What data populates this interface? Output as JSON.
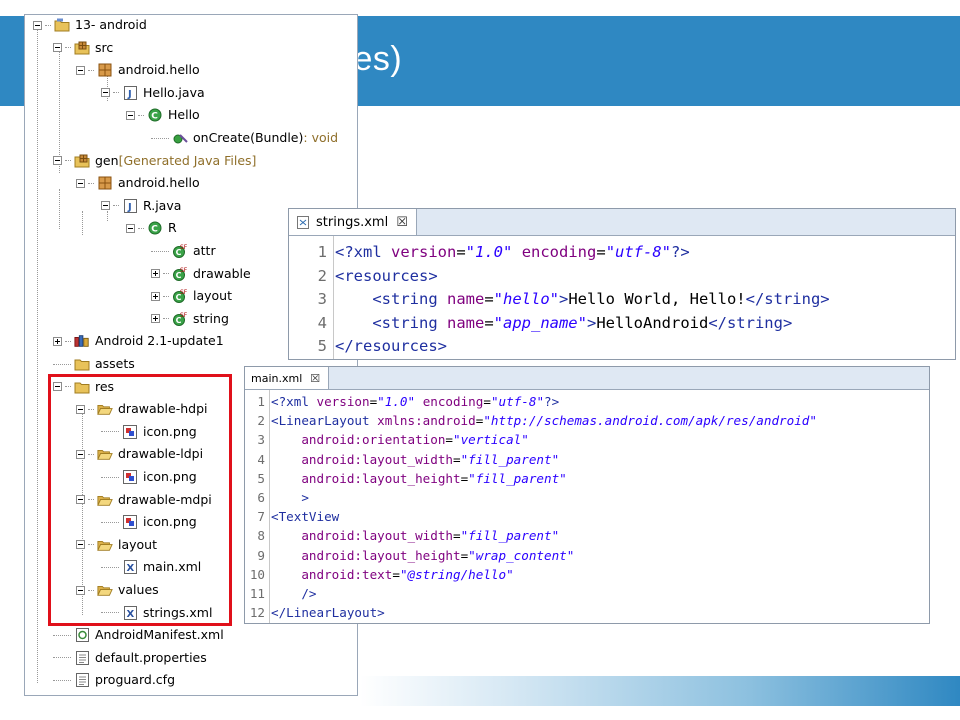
{
  "slide": {
    "title_fragment": "ces)"
  },
  "tree": [
    {
      "label": "13- android",
      "icon": "project-folder-icon"
    },
    {
      "label": "src",
      "icon": "source-folder-icon"
    },
    {
      "label": "android.hello",
      "icon": "package-icon"
    },
    {
      "label": "Hello.java",
      "icon": "java-file-icon"
    },
    {
      "label": "Hello",
      "icon": "class-icon"
    },
    {
      "label": "onCreate(Bundle)",
      "decor": " : void",
      "icon": "method-icon"
    },
    {
      "label": "gen",
      "decor": " [Generated Java Files]",
      "icon": "gen-folder-icon"
    },
    {
      "label": "android.hello",
      "icon": "package-icon"
    },
    {
      "label": "R.java",
      "icon": "java-file-icon"
    },
    {
      "label": "R",
      "icon": "class-icon"
    },
    {
      "label": "attr",
      "icon": "static-final-class-icon"
    },
    {
      "label": "drawable",
      "icon": "static-final-class-icon"
    },
    {
      "label": "layout",
      "icon": "static-final-class-icon"
    },
    {
      "label": "string",
      "icon": "static-final-class-icon"
    },
    {
      "label": "Android 2.1-update1",
      "icon": "library-icon"
    },
    {
      "label": "assets",
      "icon": "folder-icon"
    },
    {
      "label": "res",
      "icon": "folder-icon"
    },
    {
      "label": "drawable-hdpi",
      "icon": "open-folder-icon"
    },
    {
      "label": "icon.png",
      "icon": "image-file-icon"
    },
    {
      "label": "drawable-ldpi",
      "icon": "open-folder-icon"
    },
    {
      "label": "icon.png",
      "icon": "image-file-icon"
    },
    {
      "label": "drawable-mdpi",
      "icon": "open-folder-icon"
    },
    {
      "label": "icon.png",
      "icon": "image-file-icon"
    },
    {
      "label": "layout",
      "icon": "open-folder-icon"
    },
    {
      "label": "main.xml",
      "icon": "xml-file-icon"
    },
    {
      "label": "values",
      "icon": "open-folder-icon"
    },
    {
      "label": "strings.xml",
      "icon": "xml-file-icon"
    },
    {
      "label": "AndroidManifest.xml",
      "icon": "manifest-file-icon"
    },
    {
      "label": "default.properties",
      "icon": "text-file-icon"
    },
    {
      "label": "proguard.cfg",
      "icon": "text-file-icon"
    }
  ],
  "strings_editor": {
    "tab_label": "strings.xml",
    "close_glyph": "☒",
    "lines": [
      {
        "n": "1",
        "tokens": [
          [
            "tag",
            "<?xml "
          ],
          [
            "attr",
            "version"
          ],
          [
            "txt",
            "="
          ],
          [
            "val",
            "\"1.0\""
          ],
          [
            "txt",
            " "
          ],
          [
            "attr",
            "encoding"
          ],
          [
            "txt",
            "="
          ],
          [
            "val",
            "\"utf-8\""
          ],
          [
            "tag",
            "?>"
          ]
        ]
      },
      {
        "n": "2",
        "tokens": [
          [
            "tag",
            "<resources>"
          ]
        ]
      },
      {
        "n": "3",
        "tokens": [
          [
            "txt",
            "    "
          ],
          [
            "tag",
            "<string "
          ],
          [
            "attr",
            "name"
          ],
          [
            "txt",
            "="
          ],
          [
            "val",
            "\"hello\""
          ],
          [
            "tag",
            ">"
          ],
          [
            "txt",
            "Hello World, Hello!"
          ],
          [
            "tag",
            "</string>"
          ]
        ]
      },
      {
        "n": "4",
        "tokens": [
          [
            "txt",
            "    "
          ],
          [
            "tag",
            "<string "
          ],
          [
            "attr",
            "name"
          ],
          [
            "txt",
            "="
          ],
          [
            "val",
            "\"app_name\""
          ],
          [
            "tag",
            ">"
          ],
          [
            "txt",
            "HelloAndroid"
          ],
          [
            "tag",
            "</string>"
          ]
        ]
      },
      {
        "n": "5",
        "tokens": [
          [
            "tag",
            "</resources>"
          ]
        ]
      }
    ]
  },
  "main_editor": {
    "tab_label": "main.xml",
    "close_glyph": "☒",
    "lines": [
      {
        "n": "1",
        "tokens": [
          [
            "tag",
            "<?xml "
          ],
          [
            "attr",
            "version"
          ],
          [
            "txt",
            "="
          ],
          [
            "val",
            "\"1.0\""
          ],
          [
            "txt",
            " "
          ],
          [
            "attr",
            "encoding"
          ],
          [
            "txt",
            "="
          ],
          [
            "val",
            "\"utf-8\""
          ],
          [
            "tag",
            "?>"
          ]
        ]
      },
      {
        "n": "2",
        "tokens": [
          [
            "tag",
            "<LinearLayout "
          ],
          [
            "attr",
            "xmlns:android"
          ],
          [
            "txt",
            "="
          ],
          [
            "val",
            "\"http://schemas.android.com/apk/res/android\""
          ]
        ]
      },
      {
        "n": "3",
        "tokens": [
          [
            "txt",
            "    "
          ],
          [
            "attr",
            "android:orientation"
          ],
          [
            "txt",
            "="
          ],
          [
            "val",
            "\"vertical\""
          ]
        ]
      },
      {
        "n": "4",
        "tokens": [
          [
            "txt",
            "    "
          ],
          [
            "attr",
            "android:layout_width"
          ],
          [
            "txt",
            "="
          ],
          [
            "val",
            "\"fill_parent\""
          ]
        ]
      },
      {
        "n": "5",
        "tokens": [
          [
            "txt",
            "    "
          ],
          [
            "attr",
            "android:layout_height"
          ],
          [
            "txt",
            "="
          ],
          [
            "val",
            "\"fill_parent\""
          ]
        ]
      },
      {
        "n": "6",
        "tokens": [
          [
            "txt",
            "    "
          ],
          [
            "tag",
            ">"
          ]
        ]
      },
      {
        "n": "7",
        "tokens": [
          [
            "tag",
            "<TextView"
          ]
        ]
      },
      {
        "n": "8",
        "tokens": [
          [
            "txt",
            "    "
          ],
          [
            "attr",
            "android:layout_width"
          ],
          [
            "txt",
            "="
          ],
          [
            "val",
            "\"fill_parent\""
          ]
        ]
      },
      {
        "n": "9",
        "tokens": [
          [
            "txt",
            "    "
          ],
          [
            "attr",
            "android:layout_height"
          ],
          [
            "txt",
            "="
          ],
          [
            "val",
            "\"wrap_content\""
          ]
        ]
      },
      {
        "n": "10",
        "tokens": [
          [
            "txt",
            "    "
          ],
          [
            "attr",
            "android:text"
          ],
          [
            "txt",
            "="
          ],
          [
            "val",
            "\"@string/hello\""
          ]
        ]
      },
      {
        "n": "11",
        "tokens": [
          [
            "txt",
            "    "
          ],
          [
            "tag",
            "/>"
          ]
        ]
      },
      {
        "n": "12",
        "tokens": [
          [
            "tag",
            "</LinearLayout>"
          ]
        ]
      }
    ]
  }
}
